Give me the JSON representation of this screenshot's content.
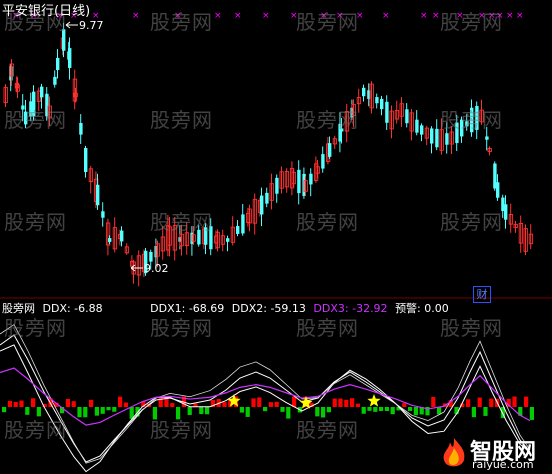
{
  "app": {
    "title": "平安银行(日线)"
  },
  "price_panel": {
    "high_label": "9.77",
    "low_label": "9.02",
    "marker_label": "财"
  },
  "indicator_panel": {
    "name": "股旁网",
    "ddx": "DDX: -6.88",
    "ddx1": "DDX1: -68.69",
    "ddx2": "DDX2: -59.13",
    "ddx3": "DDX3: -32.92",
    "warn": "预警: 0.00"
  },
  "watermark": {
    "text": "股旁网"
  },
  "brand": {
    "name": "智股网",
    "url": "raiyue.com"
  },
  "colors": {
    "up": "#ff3232",
    "down": "#54ffff",
    "ddx_up": "#ff0000",
    "ddx_down": "#00cc00",
    "ddx3": "#cc33ff",
    "star": "#ffff00",
    "marker": "#ff00ff"
  }
}
